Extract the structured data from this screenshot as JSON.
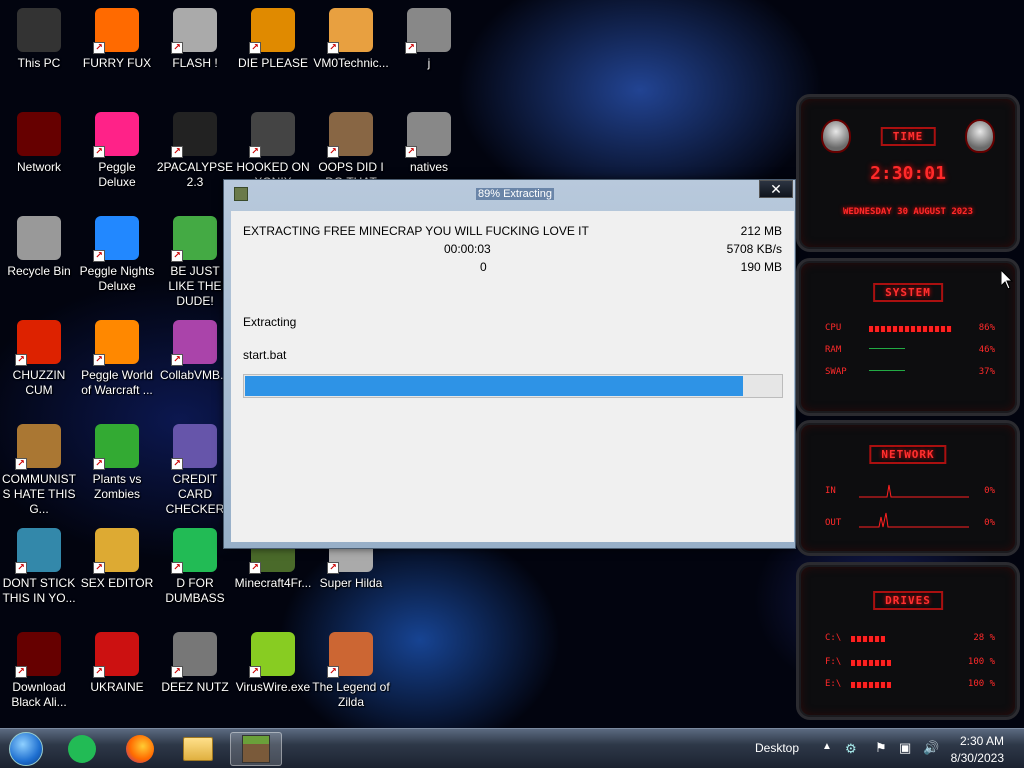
{
  "desktop_icons": [
    {
      "label": "This PC",
      "icon": "this-pc-icon",
      "color": "#333333"
    },
    {
      "label": "FURRY FUX",
      "icon": "firefox-icon",
      "color": "#ff6a00"
    },
    {
      "label": "FLASH !",
      "icon": "flash-icon",
      "color": "#aaaaaa"
    },
    {
      "label": "DIE PLEASE",
      "icon": "die-icon",
      "color": "#e08a00"
    },
    {
      "label": "VM0Technic...",
      "icon": "doctor-icon",
      "color": "#e8a040"
    },
    {
      "label": "j",
      "icon": "j-icon",
      "color": "#888888"
    },
    {
      "label": "Network",
      "icon": "network-icon",
      "color": "#660000"
    },
    {
      "label": "Peggle Deluxe",
      "icon": "peggle-icon",
      "color": "#ff2288"
    },
    {
      "label": "2PACALYPSE 2.3",
      "icon": "terminal-icon",
      "color": "#222222"
    },
    {
      "label": "HOOKED ON XONIX",
      "icon": "xonix-icon",
      "color": "#444444"
    },
    {
      "label": "OOPS DID I DO THAT",
      "icon": "portrait-icon",
      "color": "#886644"
    },
    {
      "label": "natives",
      "icon": "natives-icon",
      "color": "#888888"
    },
    {
      "label": "Recycle Bin",
      "icon": "recycle-bin-icon",
      "color": "#999999"
    },
    {
      "label": "Peggle Nights Deluxe",
      "icon": "peggle-nights-icon",
      "color": "#2288ff"
    },
    {
      "label": "BE JUST LIKE THE DUDE!",
      "icon": "santa-icon",
      "color": "#44aa44"
    },
    {
      "label": "CHUZZIN CUM",
      "icon": "chuzzle-icon",
      "color": "#dd2200"
    },
    {
      "label": "Peggle World of Warcraft ...",
      "icon": "peggle-wow-icon",
      "color": "#ff8800"
    },
    {
      "label": "CollabVMB...",
      "icon": "collabvm-icon",
      "color": "#aa44aa"
    },
    {
      "label": "COMMUNISTS HATE THIS G...",
      "icon": "money-bag-icon",
      "color": "#aa7733"
    },
    {
      "label": "Plants vs Zombies",
      "icon": "plants-icon",
      "color": "#33aa33"
    },
    {
      "label": "CREDIT CARD CHECKER",
      "icon": "credit-card-icon",
      "color": "#6655aa"
    },
    {
      "label": "DONT STICK THIS IN YO...",
      "icon": "document-icon",
      "color": "#3388aa"
    },
    {
      "label": "SEX EDITOR",
      "icon": "hxd-icon",
      "color": "#ddaa33"
    },
    {
      "label": "D FOR DUMBASS",
      "icon": "d-app-icon",
      "color": "#22bb55"
    },
    {
      "label": "Minecraft4Fr...",
      "icon": "minecraft-icon",
      "color": "#4a6a2a"
    },
    {
      "label": "Super Hilda",
      "icon": "super-hilda-icon",
      "color": "#aaaaaa"
    },
    {
      "label": "Download Black Ali...",
      "icon": "download-alien-icon",
      "color": "#660000"
    },
    {
      "label": "UKRAINE",
      "icon": "radiation-icon",
      "color": "#cc1111"
    },
    {
      "label": "DEEZ NUTZ",
      "icon": "deez-nutz-icon",
      "color": "#777777"
    },
    {
      "label": "VirusWire.exe",
      "icon": "lime-icon",
      "color": "#88cc22"
    },
    {
      "label": "The Legend of Zilda",
      "icon": "zilda-icon",
      "color": "#cc6633"
    }
  ],
  "dialog": {
    "title": "89% Extracting",
    "close_label": "✕",
    "archive_name": "EXTRACTING FREE MINECRAP YOU WILL FUCKING LOVE IT",
    "total_size": "212 MB",
    "elapsed": "00:00:03",
    "speed": "5708 KB/s",
    "remaining": "0",
    "processed": "190 MB",
    "status": "Extracting",
    "current_file": "start.bat",
    "progress_percent": 93
  },
  "gadgets": {
    "time": {
      "title": "TIME",
      "clock": "2:30:01",
      "date": "WEDNESDAY 30 AUGUST 2023"
    },
    "system": {
      "title": "SYSTEM",
      "rows": [
        {
          "label": "CPU",
          "value": "86%",
          "level": 0.86
        },
        {
          "label": "RAM",
          "value": "46%",
          "level": 0.0
        },
        {
          "label": "SWAP",
          "value": "37%",
          "level": 0.0
        }
      ]
    },
    "network": {
      "title": "NETWORK",
      "rows": [
        {
          "label": "IN",
          "value": "0%"
        },
        {
          "label": "OUT",
          "value": "0%"
        }
      ]
    },
    "drives": {
      "title": "DRIVES",
      "rows": [
        {
          "label": "C:\\",
          "value": "28 %",
          "level": 0.28
        },
        {
          "label": "F:\\",
          "value": "100 %",
          "level": 1.0
        },
        {
          "label": "E:\\",
          "value": "100 %",
          "level": 1.0
        }
      ]
    }
  },
  "taskbar": {
    "desktop_label": "Desktop",
    "time": "2:30 AM",
    "date": "8/30/2023",
    "pinned": [
      "start-orb",
      "d-app",
      "firefox",
      "file-explorer",
      "minecraft"
    ]
  },
  "colors": {
    "progress": "#2e93e6",
    "gadget_red": "#ff2a2a"
  }
}
